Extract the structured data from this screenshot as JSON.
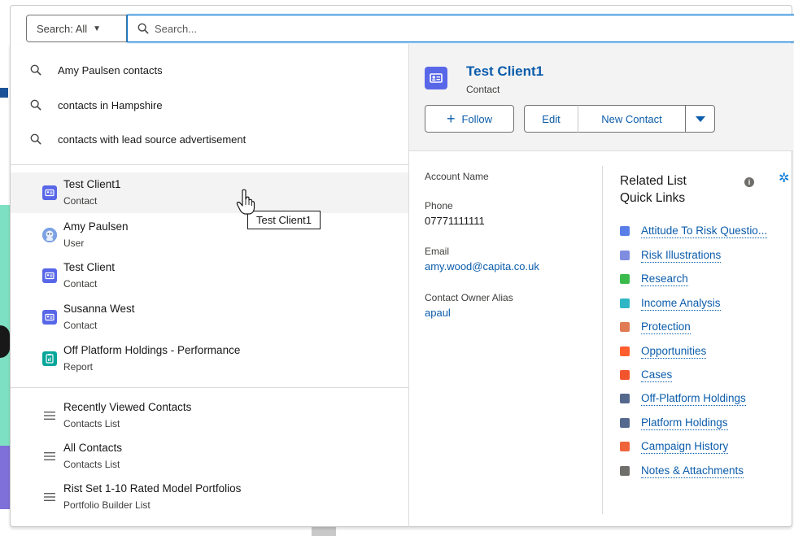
{
  "search": {
    "scope_label": "Search: All",
    "placeholder": "Search..."
  },
  "suggestions": [
    {
      "label": "Amy Paulsen contacts"
    },
    {
      "label": "contacts in Hampshire"
    },
    {
      "label": "contacts with lead source advertisement"
    }
  ],
  "records": [
    {
      "title": "Test Client1",
      "type": "Contact",
      "icon": "contact-icon"
    },
    {
      "title": "Amy Paulsen",
      "type": "User",
      "icon": "user-avatar-icon"
    },
    {
      "title": "Test Client",
      "type": "Contact",
      "icon": "contact-icon"
    },
    {
      "title": "Susanna West",
      "type": "Contact",
      "icon": "contact-icon"
    },
    {
      "title": "Off Platform Holdings - Performance",
      "type": "Report",
      "icon": "report-icon"
    }
  ],
  "lists": [
    {
      "title": "Recently Viewed Contacts",
      "type": "Contacts List"
    },
    {
      "title": "All Contacts",
      "type": "Contacts List"
    },
    {
      "title": "Rist Set 1-10 Rated Model Portfolios",
      "type": "Portfolio Builder List"
    }
  ],
  "tooltip": "Test Client1",
  "preview": {
    "title": "Test Client1",
    "subtitle": "Contact",
    "follow_label": "Follow",
    "edit_label": "Edit",
    "new_contact_label": "New Contact",
    "fields": {
      "account_name_label": "Account Name",
      "account_name_value": "",
      "phone_label": "Phone",
      "phone_value": "07771111111",
      "email_label": "Email",
      "email_value": "amy.wood@capita.co.uk",
      "owner_label": "Contact Owner Alias",
      "owner_value": "apaul"
    },
    "related_title": "Related List Quick Links",
    "quick_links": [
      {
        "label": "Attitude To Risk Questio...",
        "color": "#5a7ee8"
      },
      {
        "label": "Risk Illustrations",
        "color": "#7f8de1"
      },
      {
        "label": "Research",
        "color": "#3bba4c"
      },
      {
        "label": "Income Analysis",
        "color": "#2fb6c4"
      },
      {
        "label": "Protection",
        "color": "#e07b53"
      },
      {
        "label": "Opportunities",
        "color": "#ff5d2d"
      },
      {
        "label": "Cases",
        "color": "#f2542d"
      },
      {
        "label": "Off-Platform Holdings",
        "color": "#54698d"
      },
      {
        "label": "Platform Holdings",
        "color": "#54698d"
      },
      {
        "label": "Campaign History",
        "color": "#f0643c"
      },
      {
        "label": "Notes & Attachments",
        "color": "#706e6b"
      }
    ]
  },
  "colors": {
    "accent": "#0176d3",
    "link": "#0b5cab",
    "contact_icon": "#5867e8",
    "report_icon": "#06a59a"
  }
}
